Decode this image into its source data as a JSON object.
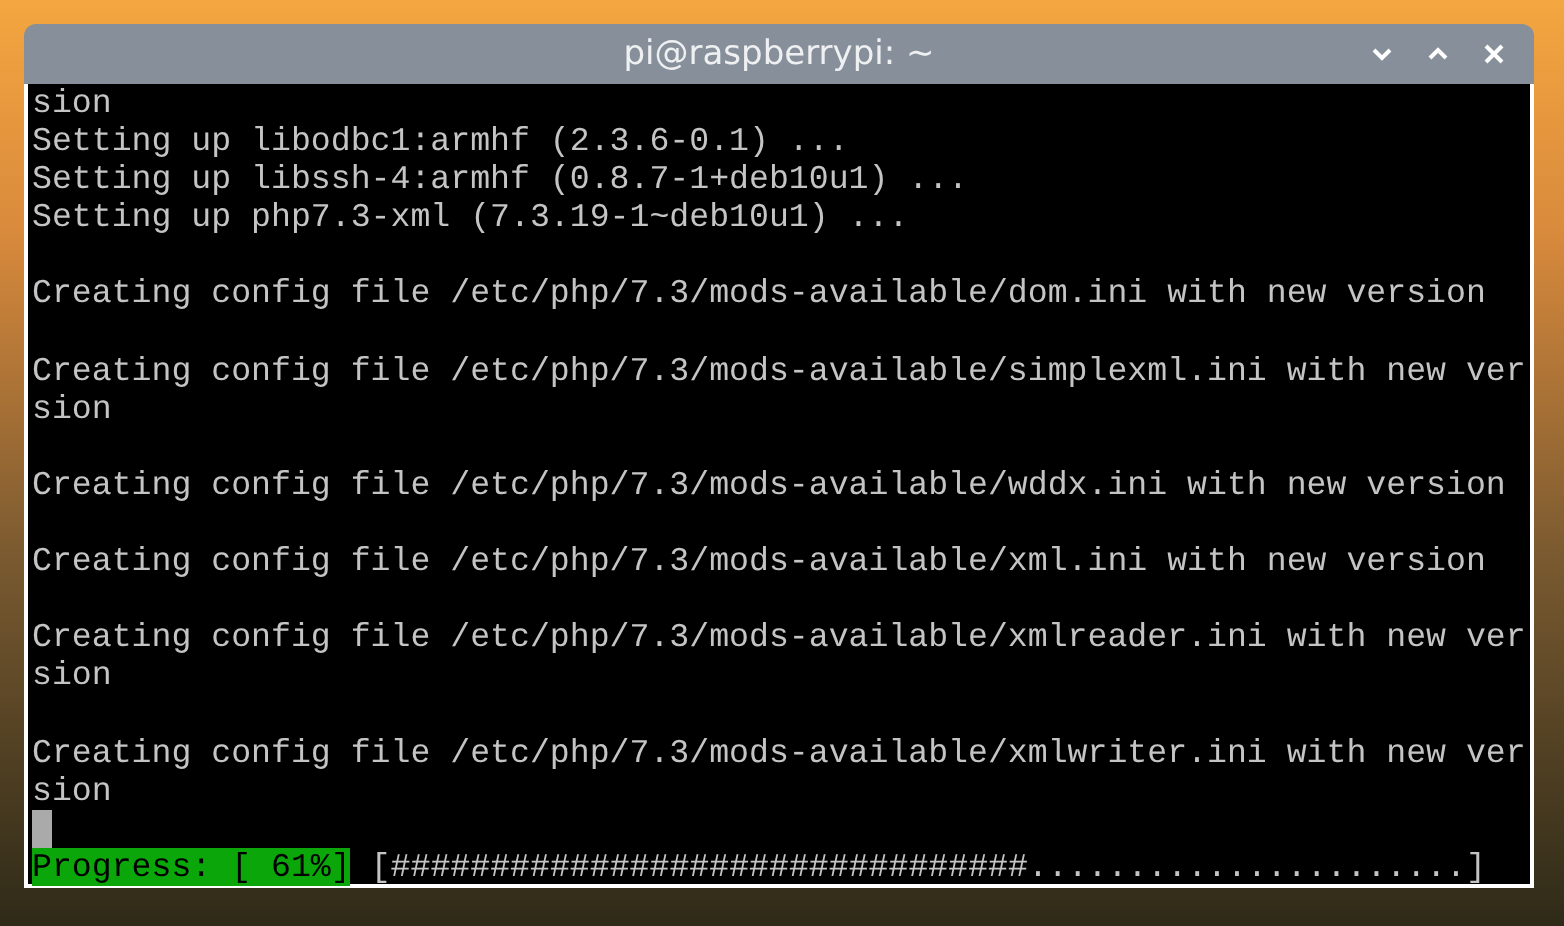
{
  "window": {
    "title": "pi@raspberrypi: ~"
  },
  "terminal": {
    "blocks": [
      [
        "sion",
        "Setting up libodbc1:armhf (2.3.6-0.1) ...",
        "Setting up libssh-4:armhf (0.8.7-1+deb10u1) ...",
        "Setting up php7.3-xml (7.3.19-1~deb10u1) ..."
      ],
      [
        "Creating config file /etc/php/7.3/mods-available/dom.ini with new version"
      ],
      [
        "Creating config file /etc/php/7.3/mods-available/simplexml.ini with new ver",
        "sion"
      ],
      [
        "Creating config file /etc/php/7.3/mods-available/wddx.ini with new version"
      ],
      [
        "Creating config file /etc/php/7.3/mods-available/xml.ini with new version"
      ],
      [
        "Creating config file /etc/php/7.3/mods-available/xmlreader.ini with new ver",
        "sion"
      ],
      [
        "Creating config file /etc/php/7.3/mods-available/xmlwriter.ini with new ver",
        "sion"
      ]
    ],
    "progress": {
      "label": "Progress: [ 61%]",
      "bar": "[################################......................]"
    }
  }
}
